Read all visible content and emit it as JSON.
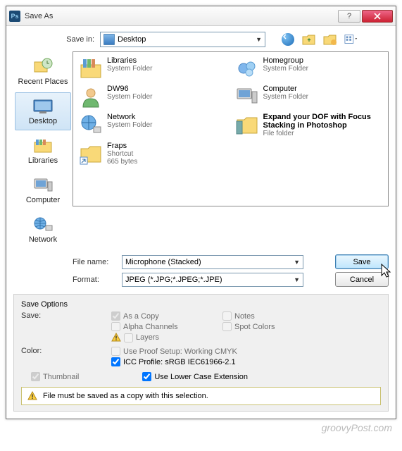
{
  "window": {
    "title": "Save As"
  },
  "savein": {
    "label": "Save in:",
    "value": "Desktop"
  },
  "places": [
    {
      "key": "recent",
      "label": "Recent Places"
    },
    {
      "key": "desktop",
      "label": "Desktop",
      "selected": true
    },
    {
      "key": "libraries",
      "label": "Libraries"
    },
    {
      "key": "computer",
      "label": "Computer"
    },
    {
      "key": "network",
      "label": "Network"
    }
  ],
  "files": {
    "col1": [
      {
        "name": "Libraries",
        "sub": "System Folder",
        "icon": "libraries"
      },
      {
        "name": "DW96",
        "sub": "System Folder",
        "icon": "user"
      },
      {
        "name": "Network",
        "sub": "System Folder",
        "icon": "network"
      },
      {
        "name": "Fraps",
        "sub": "Shortcut\n665 bytes",
        "icon": "folder-shortcut"
      }
    ],
    "col2": [
      {
        "name": "Homegroup",
        "sub": "System Folder",
        "icon": "homegroup"
      },
      {
        "name": "Computer",
        "sub": "System Folder",
        "icon": "computer"
      },
      {
        "name": "Expand your DOF with Focus Stacking in Photoshop",
        "sub": "File folder",
        "icon": "folder"
      }
    ]
  },
  "filename": {
    "label": "File name:",
    "value": "Microphone (Stacked)"
  },
  "format": {
    "label": "Format:",
    "value": "JPEG (*.JPG;*.JPEG;*.JPE)"
  },
  "buttons": {
    "save": "Save",
    "cancel": "Cancel"
  },
  "saveoptions": {
    "heading": "Save Options",
    "save_label": "Save:",
    "as_a_copy": "As a Copy",
    "notes": "Notes",
    "alpha": "Alpha Channels",
    "spot": "Spot Colors",
    "layers": "Layers",
    "color_label": "Color:",
    "proof": "Use Proof Setup:  Working CMYK",
    "icc": "ICC Profile:  sRGB IEC61966-2.1",
    "thumbnail": "Thumbnail",
    "lowercase": "Use Lower Case Extension"
  },
  "notice": "File must be saved as a copy with this selection.",
  "watermark": "groovyPost.com"
}
